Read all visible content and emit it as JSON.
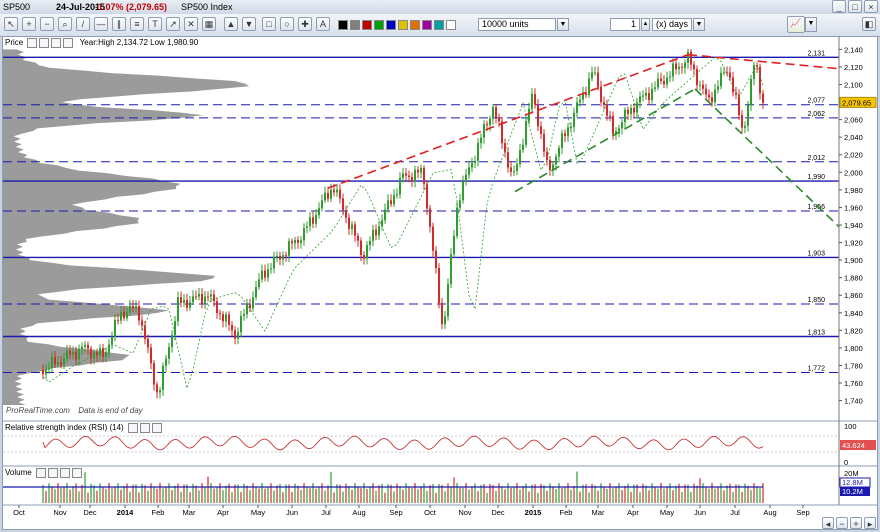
{
  "window": {
    "instrument": "SP500",
    "date": "24-Jul-2015",
    "change": "-1.07% (2,079.65)",
    "index_name": "SP500 Index"
  },
  "toolbar": {
    "units_value": "10000 units",
    "period_value": "1",
    "period_unit": "(x) days"
  },
  "price_panel": {
    "label": "Price",
    "year_range": "Year:High 2,134.72 Low 1,980.90",
    "current_price": "2,079.65",
    "levels": [
      {
        "label": "2,131",
        "value": 2131,
        "style": "solid"
      },
      {
        "label": "2,077",
        "value": 2077,
        "style": "dash"
      },
      {
        "label": "2,062",
        "value": 2062,
        "style": "dash"
      },
      {
        "label": "2,012",
        "value": 2012,
        "style": "dash"
      },
      {
        "label": "1,990",
        "value": 1990,
        "style": "solid"
      },
      {
        "label": "1,956",
        "value": 1956,
        "style": "dash"
      },
      {
        "label": "1,903",
        "value": 1903,
        "style": "solid"
      },
      {
        "label": "1,850",
        "value": 1850,
        "style": "dash"
      },
      {
        "label": "1,813",
        "value": 1813,
        "style": "solid"
      },
      {
        "label": "1,772",
        "value": 1772,
        "style": "dash"
      }
    ],
    "axis_ticks": [
      "2,140",
      "2,120",
      "2,100",
      "2,080",
      "2,060",
      "2,040",
      "2,020",
      "2,000",
      "1,980",
      "1,960",
      "1,940",
      "1,920",
      "1,900",
      "1,880",
      "1,860",
      "1,840",
      "1,820",
      "1,800",
      "1,780",
      "1,760",
      "1,740"
    ],
    "watermark": "ProRealTime.com",
    "note": "Data is end of day"
  },
  "rsi_panel": {
    "label": "Relative strength index (RSI) (14)",
    "axis_top": "100",
    "axis_bottom": "0",
    "value": "43.624"
  },
  "volume_panel": {
    "label": "Volume",
    "axis_top": "20M",
    "value1": "12.8M",
    "value2": "10.2M"
  },
  "x_axis": [
    "Oct",
    "Nov",
    "Dec",
    "2014",
    "Feb",
    "Mar",
    "Apr",
    "May",
    "Jun",
    "Jul",
    "Aug",
    "Sep",
    "Oct",
    "Nov",
    "Dec",
    "2015",
    "Feb",
    "Mar",
    "Apr",
    "May",
    "Jun",
    "Jul",
    "Aug",
    "Sep"
  ],
  "colors": {
    "up": "#2e9e2e",
    "down": "#d42a2a",
    "level": "#1a1ab0",
    "profile": "#8a8a8a",
    "trend_red": "#e02020",
    "trend_green": "#2e9e2e"
  }
}
